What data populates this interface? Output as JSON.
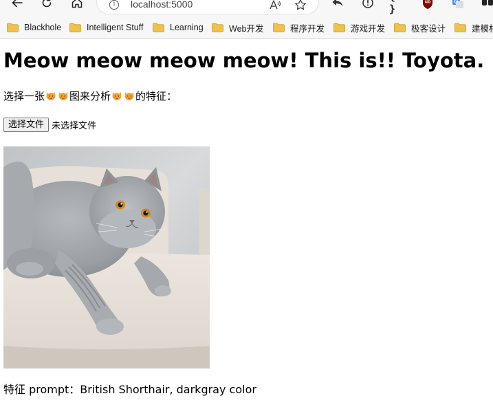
{
  "browser": {
    "url": "localhost:5000",
    "nav_icons": [
      "back-arrow-icon",
      "refresh-icon",
      "home-icon"
    ],
    "toolbar_icons": [
      "reply-icon",
      "info-circle-icon",
      "braces-icon",
      "ublock-shield-icon",
      "translate-icon",
      "extensions-icon"
    ],
    "ublock_label": "ub",
    "braces_label": "{ }",
    "bookmarks": [
      {
        "label": "Blackhole"
      },
      {
        "label": "Intelligent Stuff"
      },
      {
        "label": "Learning"
      },
      {
        "label": "Web开发"
      },
      {
        "label": "程序开发"
      },
      {
        "label": "游戏开发"
      },
      {
        "label": "极客设计"
      },
      {
        "label": "建模相"
      }
    ],
    "colors": {
      "folder": "#f0c24b",
      "ublock": "#800000",
      "translate": "#4a87f0"
    }
  },
  "page": {
    "title": "Meow meow meow meow! This is!! Toyota.",
    "instruction_parts": [
      "选择一张",
      "图来分析",
      "的特征："
    ],
    "emoji": "cat-face-emoji",
    "file_button_label": "选择文件",
    "file_status": "未选择文件",
    "image_subject": "gray-british-shorthair-cat-photo",
    "result_text": "特征 prompt：British Shorthair, darkgray color"
  }
}
